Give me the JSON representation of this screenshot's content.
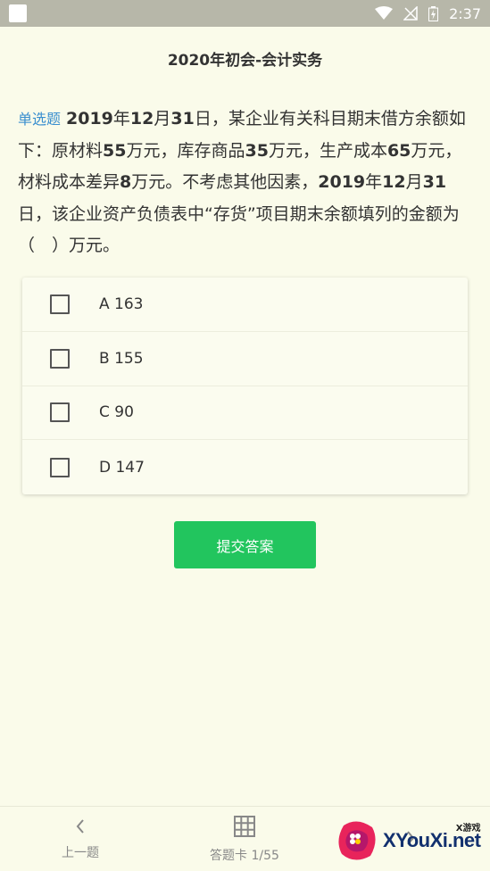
{
  "status_bar": {
    "time": "2:37",
    "icons": [
      "wifi-icon",
      "signal-off-icon",
      "battery-icon"
    ]
  },
  "header": {
    "title": "2020年初会-会计实务"
  },
  "question": {
    "type_label": "单选题",
    "text_parts": [
      {
        "t": "2019",
        "b": true
      },
      {
        "t": "年",
        "b": false
      },
      {
        "t": "12",
        "b": true
      },
      {
        "t": "月",
        "b": false
      },
      {
        "t": "31",
        "b": true
      },
      {
        "t": "日，某企业有关科目期末借方余额如下：原材料",
        "b": false
      },
      {
        "t": "55",
        "b": true
      },
      {
        "t": "万元，库存商品",
        "b": false
      },
      {
        "t": "35",
        "b": true
      },
      {
        "t": "万元，生产成本",
        "b": false
      },
      {
        "t": "65",
        "b": true
      },
      {
        "t": "万元，材料成本差异",
        "b": false
      },
      {
        "t": "8",
        "b": true
      },
      {
        "t": "万元。不考虑其他因素，",
        "b": false
      },
      {
        "t": "2019",
        "b": true
      },
      {
        "t": "年",
        "b": false
      },
      {
        "t": "12",
        "b": true
      },
      {
        "t": "月",
        "b": false
      },
      {
        "t": "31",
        "b": true
      },
      {
        "t": "日，该企业资产负债表中“存货”项目期末余额填列的金额为（　）万元。",
        "b": false
      }
    ]
  },
  "options": [
    {
      "label": "A 163",
      "checked": false
    },
    {
      "label": "B 155",
      "checked": false
    },
    {
      "label": "C 90",
      "checked": false
    },
    {
      "label": "D 147",
      "checked": false
    }
  ],
  "submit_label": "提交答案",
  "bottom_nav": {
    "prev_label": "上一题",
    "card_label": "答题卡 1/55"
  },
  "watermark": {
    "main": "XYouXi.net",
    "sub": "X游戏"
  },
  "colors": {
    "background": "#fafbea",
    "accent_green": "#22c55e",
    "question_type_blue": "#3a8fcf"
  }
}
